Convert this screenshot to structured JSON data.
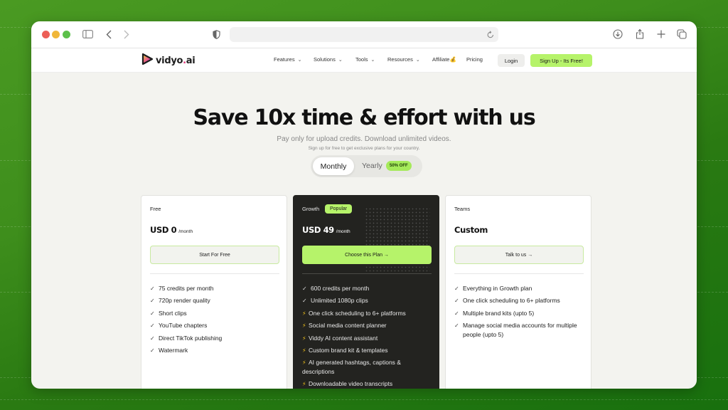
{
  "browser": {
    "url": "",
    "icons": [
      "sidebar-icon",
      "back-icon",
      "forward-icon",
      "privacy-shield-icon",
      "reload-icon",
      "download-icon",
      "share-icon",
      "new-tab-icon",
      "tab-overview-icon"
    ]
  },
  "site": {
    "logo_text": "vidyo",
    "logo_dot": ".",
    "logo_suffix": "ai",
    "nav": [
      {
        "label": "Features",
        "dropdown": true
      },
      {
        "label": "Solutions",
        "dropdown": true
      },
      {
        "label": "Tools",
        "dropdown": true
      },
      {
        "label": "Resources",
        "dropdown": true
      },
      {
        "label": "Affiliate💰",
        "dropdown": false
      },
      {
        "label": "Pricing",
        "dropdown": false
      }
    ],
    "login_label": "Login",
    "signup_label": "Sign Up - Its Free!"
  },
  "hero": {
    "title": "Save 10x time & effort with us",
    "subtitle": "Pay only for upload credits. Download unlimited videos.",
    "note": "Sign up for free to get exclusive plans for your country.",
    "billing_toggle": {
      "monthly_label": "Monthly",
      "yearly_label": "Yearly",
      "yearly_badge": "50% OFF",
      "selected": "Monthly"
    }
  },
  "plans": [
    {
      "name": "Free",
      "price": "USD 0",
      "period": "/month",
      "cta": "Start For Free",
      "features": [
        {
          "icon": "check",
          "text": "75 credits per month"
        },
        {
          "icon": "check",
          "text": "720p render quality"
        },
        {
          "icon": "check",
          "text": "Short clips"
        },
        {
          "icon": "check",
          "text": "YouTube chapters"
        },
        {
          "icon": "check",
          "text": "Direct TikTok publishing"
        },
        {
          "icon": "check",
          "text": "Watermark"
        }
      ]
    },
    {
      "name": "Growth",
      "badge": "Popular",
      "price": "USD 49",
      "period": "/month",
      "cta": "Choose this Plan →",
      "features": [
        {
          "icon": "check",
          "text": "600 credits per month"
        },
        {
          "icon": "check",
          "text": "Unlimited 1080p clips"
        },
        {
          "icon": "bolt",
          "text": "One click scheduling to 6+ platforms"
        },
        {
          "icon": "bolt",
          "text": "Social media content planner"
        },
        {
          "icon": "bolt",
          "text": "Viddy AI content assistant"
        },
        {
          "icon": "bolt",
          "text": "Custom brand kit & templates"
        },
        {
          "icon": "bolt",
          "text": "AI generated hashtags, captions & descriptions"
        },
        {
          "icon": "bolt",
          "text": "Downloadable video transcripts"
        }
      ]
    },
    {
      "name": "Teams",
      "price": "Custom",
      "cta": "Talk to us →",
      "features": [
        {
          "icon": "check",
          "text": "Everything in Growth plan"
        },
        {
          "icon": "check",
          "text": "One click scheduling to 6+ platforms"
        },
        {
          "icon": "check",
          "text": "Multiple brand kits (upto 5)"
        },
        {
          "icon": "check",
          "text": "Manage social media accounts for multiple people (upto 5)"
        }
      ]
    }
  ],
  "colors": {
    "accent_green": "#b6f36a",
    "dark_card": "#232320",
    "page_bg": "#f3f3ef",
    "desktop_green": "#3e8e1c",
    "logo_accent": "#e0367a"
  }
}
